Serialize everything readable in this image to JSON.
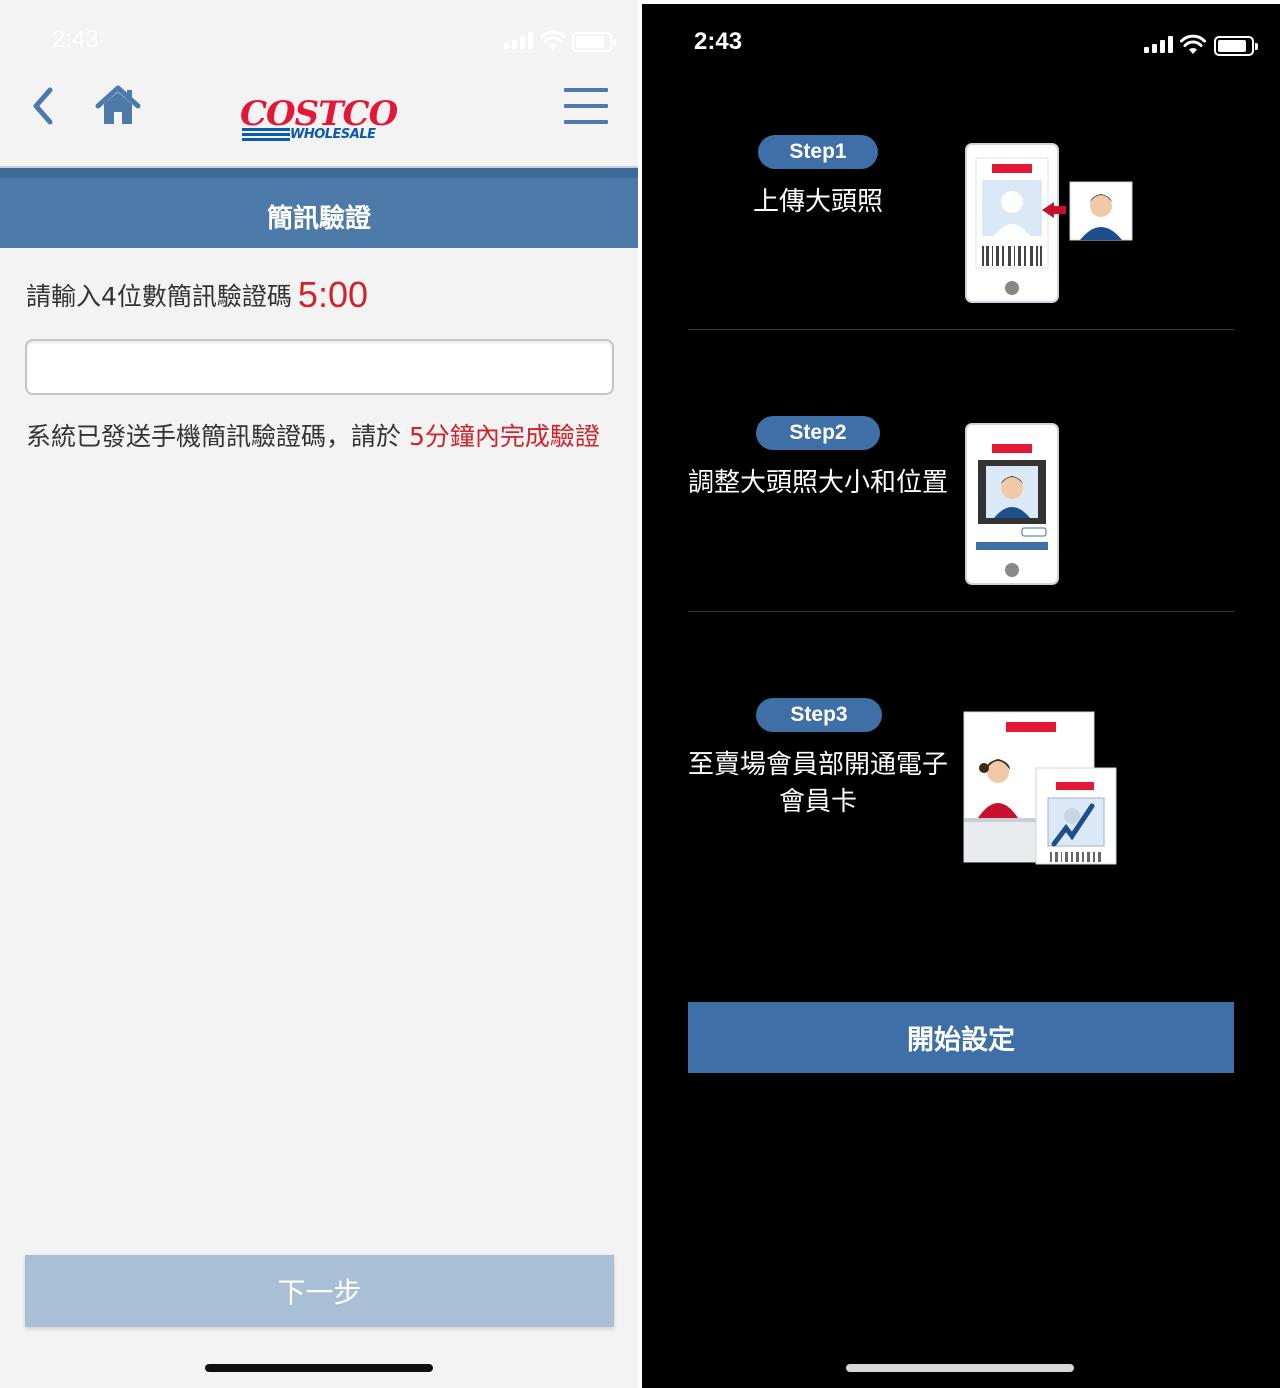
{
  "left": {
    "status_time": "2:43",
    "header": {
      "logo_top": "COSTCO",
      "logo_bottom": "WHOLESALE"
    },
    "title": "簡訊驗證",
    "prompt": "請輸入4位數簡訊驗證碼",
    "timer": "5:00",
    "code_input": {
      "value": "",
      "placeholder": ""
    },
    "notice_text": "系統已發送手機簡訊驗證碼，請於 ",
    "notice_highlight": "5分鐘內完成驗證",
    "next_button": "下一步"
  },
  "right": {
    "status_time": "2:43",
    "steps": [
      {
        "label": "Step1",
        "desc": "上傳大頭照"
      },
      {
        "label": "Step2",
        "desc": "調整大頭照大小和位置"
      },
      {
        "label": "Step3",
        "desc": "至賣場會員部開通電子會員卡"
      }
    ],
    "start_button": "開始設定"
  },
  "colors": {
    "brand_blue": "#4d7aa8",
    "dark_blue": "#3e6fa6",
    "accent_red": "#d0242d",
    "disabled_button": "#a9bfd5"
  }
}
